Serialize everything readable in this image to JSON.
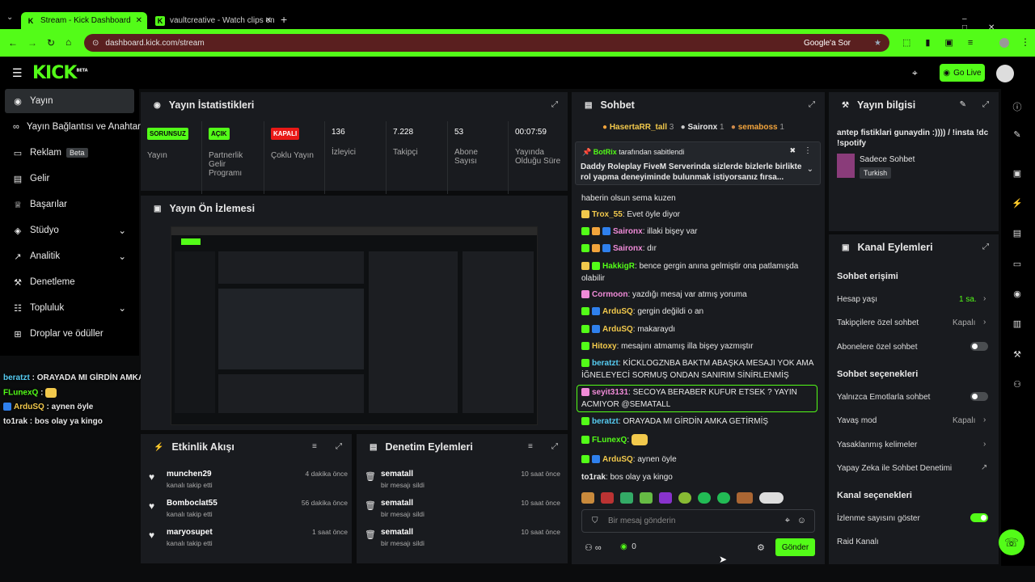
{
  "browser": {
    "tabs": [
      {
        "label": "Stream - Kick Dashboard"
      },
      {
        "label": "vaultcreative - Watch clips on K"
      }
    ],
    "url": "dashboard.kick.com/stream",
    "google_btn": "Google'a Sor"
  },
  "app": {
    "logo": "KICK",
    "logo_beta": "BETA",
    "go_live": "Go Live"
  },
  "sidebar": {
    "items": [
      {
        "label": "Yayın"
      },
      {
        "label": "Yayın Bağlantısı ve Anahtar"
      },
      {
        "label": "Reklam",
        "badge": "Beta"
      },
      {
        "label": "Gelir"
      },
      {
        "label": "Başarılar"
      },
      {
        "label": "Stüdyo"
      },
      {
        "label": "Analitik"
      },
      {
        "label": "Denetleme"
      },
      {
        "label": "Topluluk"
      },
      {
        "label": "Droplar ve ödüller"
      }
    ]
  },
  "overlay_chat": [
    {
      "user": "beratzt",
      "msg": "ORAYADA MI GİRDİN AMKA GETİRMİŞ"
    },
    {
      "user": "FLunexQ",
      "msg": ""
    },
    {
      "user": "ArduSQ",
      "msg": "aynen öyle"
    },
    {
      "user": "to1rak",
      "msg": "bos olay ya kingo"
    }
  ],
  "stats": {
    "title": "Yayın İstatistikleri",
    "cells": [
      {
        "tag": "SORUNSUZ",
        "label": "Yayın"
      },
      {
        "tag": "AÇIK",
        "label": "Partnerlik Gelir Programı"
      },
      {
        "tag": "KAPALI",
        "label": "Çoklu Yayın"
      },
      {
        "value": "136",
        "label": "İzleyici"
      },
      {
        "value": "7.228",
        "label": "Takipçi"
      },
      {
        "value": "53",
        "label": "Abone Sayısı"
      },
      {
        "value": "00:07:59",
        "label": "Yayında Olduğu Süre"
      }
    ]
  },
  "preview": {
    "title": "Yayın Ön İzlemesi"
  },
  "activity": {
    "title": "Etkinlik Akışı",
    "items": [
      {
        "name": "munchen29",
        "sub": "kanalı takip etti",
        "time": "4 dakika önce"
      },
      {
        "name": "Bomboclat55",
        "sub": "kanalı takip etti",
        "time": "56 dakika önce"
      },
      {
        "name": "maryosupet",
        "sub": "kanalı takip etti",
        "time": "1 saat önce"
      }
    ]
  },
  "moderation": {
    "title": "Denetim Eylemleri",
    "items": [
      {
        "name": "sematall",
        "sub": "bir mesajı sildi",
        "time": "10 saat önce"
      },
      {
        "name": "sematall",
        "sub": "bir mesajı sildi",
        "time": "10 saat önce"
      },
      {
        "name": "sematall",
        "sub": "bir mesajı sildi",
        "time": "10 saat önce"
      }
    ]
  },
  "chat": {
    "title": "Sohbet",
    "top_gifters": [
      {
        "name": "HasertaRR_tall",
        "count": "3"
      },
      {
        "name": "Saironx",
        "count": "1"
      },
      {
        "name": "semaboss",
        "count": "1"
      }
    ],
    "pinned_by": "BotRix",
    "pinned_suffix": "tarafından sabitlendi",
    "pinned_msg": "Daddy Roleplay FiveM Serverinda sizlerde bizlerle birlikte rol yapma deneyiminde bulunmak istiyorsanız fırsa...",
    "messages": [
      {
        "user": "",
        "msg": "haberin olsun sema kuzen",
        "color": "#e8e8e8"
      },
      {
        "user": "Trox_55",
        "msg": "Evet öyle diyor",
        "color": "#f2c94c"
      },
      {
        "user": "Saironx",
        "msg": "illaki bişey var",
        "color": "#f08bd8"
      },
      {
        "user": "Saironx",
        "msg": "dır",
        "color": "#f08bd8"
      },
      {
        "user": "HakkigR",
        "msg": "bence gergin anına gelmiştir ona patlamışda olabilir",
        "color": "#53fc18"
      },
      {
        "user": "Cormoon",
        "msg": "yazdığı mesaj var atmış yoruma",
        "color": "#f08bd8"
      },
      {
        "user": "ArduSQ",
        "msg": "gergin değildi o an",
        "color": "#f2c94c"
      },
      {
        "user": "ArduSQ",
        "msg": "makaraydı",
        "color": "#f2c94c"
      },
      {
        "user": "Hitoxy",
        "msg": "mesajını atmamış illa bişey yazmıştır",
        "color": "#f2c94c"
      },
      {
        "user": "beratzt",
        "msg": "KİCKLOGZNBA BAKTM ABAŞKA MESAJI YOK AMA İĞNELEYECİ SORMUŞ ONDAN SANIRIM SİNİRLENMİŞ",
        "color": "#56ccf2"
      },
      {
        "user": "seyit3131",
        "msg": "SECOYA BERABER KUFUR ETSEK ? YAYIN ACMIYOR @SEMATALL",
        "color": "#f08bd8"
      },
      {
        "user": "beratzt",
        "msg": "ORAYADA MI GİRDİN AMKA GETİRMİŞ",
        "color": "#56ccf2"
      },
      {
        "user": "FLunexQ",
        "msg": "",
        "color": "#53fc18"
      },
      {
        "user": "ArduSQ",
        "msg": "aynen öyle",
        "color": "#f2c94c"
      },
      {
        "user": "to1rak",
        "msg": "bos olay ya kingo",
        "color": "#e8e8e8"
      }
    ],
    "input_placeholder": "Bir mesaj gönderin",
    "send": "Gönder",
    "points": "0"
  },
  "info": {
    "title": "Yayın bilgisi",
    "stream_title": "antep fistiklari gunaydin :)))) / !insta !dc !spotify",
    "category": "Sadece Sohbet",
    "language": "Turkish"
  },
  "channel": {
    "title": "Kanal Eylemleri",
    "chat_access": "Sohbet erişimi",
    "account_age": "Hesap yaşı",
    "account_age_val": "1 sa.",
    "followers_only": "Takipçilere özel sohbet",
    "followers_only_val": "Kapalı",
    "subs_only": "Abonelere özel sohbet",
    "chat_options": "Sohbet seçenekleri",
    "emote_only": "Yalnızca Emotlarla sohbet",
    "slow_mode": "Yavaş mod",
    "slow_mode_val": "Kapalı",
    "banned_words": "Yasaklanmış kelimeler",
    "ai_mod": "Yapay Zeka ile Sohbet Denetimi",
    "channel_options": "Kanal seçenekleri",
    "show_viewers": "İzlenme sayısını göster",
    "raid": "Raid Kanalı"
  },
  "colors": {
    "accent": "#53fc18",
    "panel": "#191b1f",
    "danger": "#e91916"
  }
}
